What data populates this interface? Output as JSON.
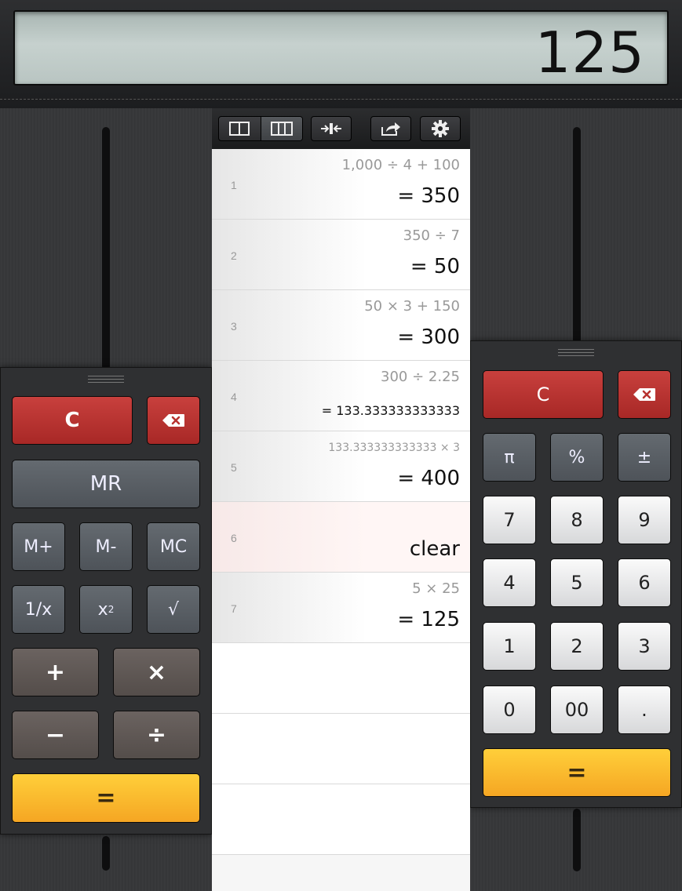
{
  "display": {
    "value": "125"
  },
  "toolbar": {
    "layout_one_icon": "single-column-icon",
    "layout_two_icon": "three-column-icon",
    "collapse_icon": "collapse-arrows-icon",
    "share_icon": "share-icon",
    "settings_icon": "gear-icon"
  },
  "history": [
    {
      "num": "1",
      "expr": "1,000 ÷ 4 + 100",
      "result": "= 350"
    },
    {
      "num": "2",
      "expr": "350 ÷ 7",
      "result": "= 50"
    },
    {
      "num": "3",
      "expr": "50 × 3 + 150",
      "result": "= 300"
    },
    {
      "num": "4",
      "expr": "300 ÷ 2.25",
      "result": "= 133.333333333333"
    },
    {
      "num": "5",
      "expr": "133.333333333333 × 3",
      "result": "= 400"
    },
    {
      "num": "6",
      "expr": "",
      "result": "clear"
    },
    {
      "num": "7",
      "expr": "5 × 25",
      "result": "= 125"
    }
  ],
  "left_pad": {
    "clear": "C",
    "mr": "MR",
    "m_plus": "M+",
    "m_minus": "M-",
    "mc": "MC",
    "reciprocal": "1/x",
    "square_base": "x",
    "square_exp": "2",
    "sqrt": "√",
    "plus": "+",
    "times": "×",
    "minus": "−",
    "divide": "÷",
    "equals": "="
  },
  "right_pad": {
    "clear": "C",
    "pi": "π",
    "percent": "%",
    "sign": "±",
    "digits": [
      "7",
      "8",
      "9",
      "4",
      "5",
      "6",
      "1",
      "2",
      "3"
    ],
    "zero": "0",
    "double_zero": "00",
    "decimal": ".",
    "equals": "="
  },
  "colors": {
    "red_key": "#b83330",
    "yellow_key": "#f9b92e",
    "lcd": "#bcc8c5"
  }
}
